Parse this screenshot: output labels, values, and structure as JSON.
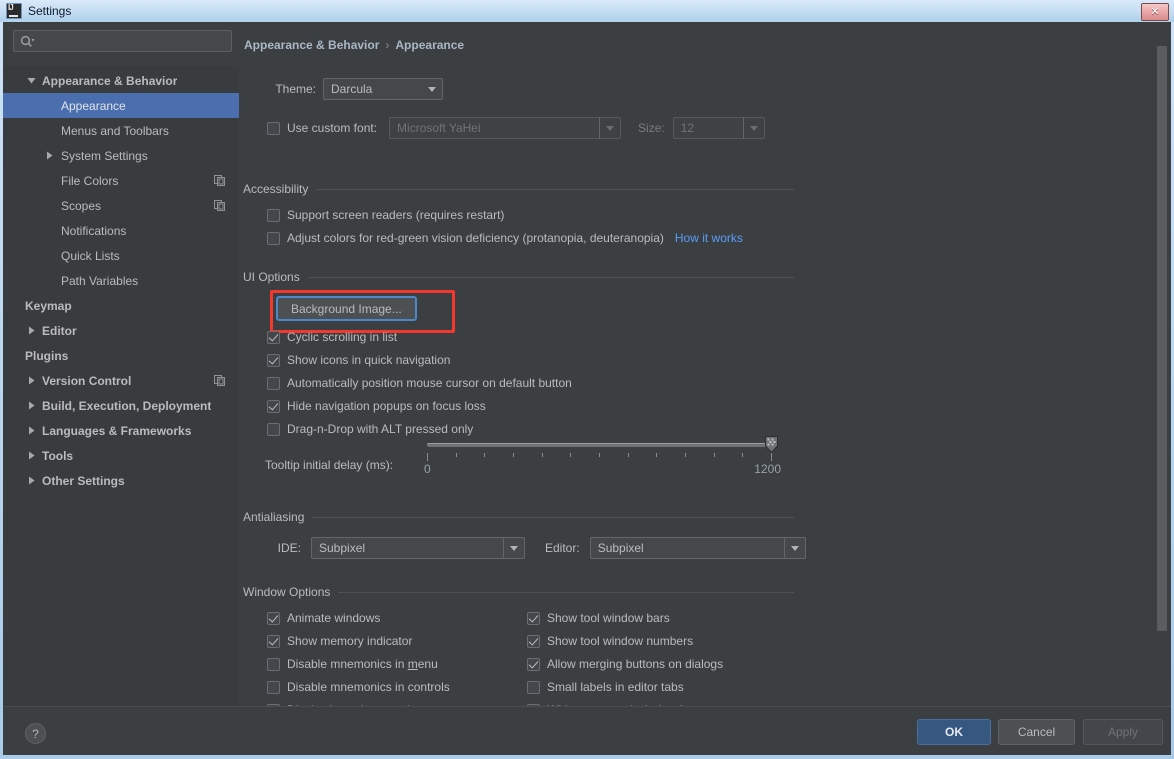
{
  "window": {
    "title": "Settings",
    "close_label": "✕",
    "app_icon": "intellij-idea-icon"
  },
  "sidebar": {
    "search_placeholder": "",
    "search_value": "",
    "search_icon": "search-icon",
    "items": [
      {
        "label": "Appearance & Behavior",
        "level": 0,
        "arrow": "expanded",
        "selected": false,
        "copy_icon": false
      },
      {
        "label": "Appearance",
        "level": 1,
        "arrow": "none",
        "selected": true,
        "copy_icon": false
      },
      {
        "label": "Menus and Toolbars",
        "level": 1,
        "arrow": "none",
        "selected": false,
        "copy_icon": false
      },
      {
        "label": "System Settings",
        "level": 1,
        "arrow": "collapsed",
        "selected": false,
        "copy_icon": false
      },
      {
        "label": "File Colors",
        "level": 1,
        "arrow": "none",
        "selected": false,
        "copy_icon": true
      },
      {
        "label": "Scopes",
        "level": 1,
        "arrow": "none",
        "selected": false,
        "copy_icon": true
      },
      {
        "label": "Notifications",
        "level": 1,
        "arrow": "none",
        "selected": false,
        "copy_icon": false
      },
      {
        "label": "Quick Lists",
        "level": 1,
        "arrow": "none",
        "selected": false,
        "copy_icon": false
      },
      {
        "label": "Path Variables",
        "level": 1,
        "arrow": "none",
        "selected": false,
        "copy_icon": false
      },
      {
        "label": "Keymap",
        "level": 0,
        "arrow": "none",
        "selected": false,
        "copy_icon": false
      },
      {
        "label": "Editor",
        "level": 0,
        "arrow": "collapsed",
        "selected": false,
        "copy_icon": false
      },
      {
        "label": "Plugins",
        "level": 0,
        "arrow": "none",
        "selected": false,
        "copy_icon": false
      },
      {
        "label": "Version Control",
        "level": 0,
        "arrow": "collapsed",
        "selected": false,
        "copy_icon": true
      },
      {
        "label": "Build, Execution, Deployment",
        "level": 0,
        "arrow": "collapsed",
        "selected": false,
        "copy_icon": false
      },
      {
        "label": "Languages & Frameworks",
        "level": 0,
        "arrow": "collapsed",
        "selected": false,
        "copy_icon": false
      },
      {
        "label": "Tools",
        "level": 0,
        "arrow": "collapsed",
        "selected": false,
        "copy_icon": false
      },
      {
        "label": "Other Settings",
        "level": 0,
        "arrow": "collapsed",
        "selected": false,
        "copy_icon": false
      }
    ]
  },
  "breadcrumb": {
    "parent": "Appearance & Behavior",
    "separator": "›",
    "current": "Appearance"
  },
  "theme_row": {
    "label": "Theme:",
    "value": "Darcula"
  },
  "font_row": {
    "checkbox_label": "Use custom font:",
    "checked": false,
    "font_value": "Microsoft YaHei",
    "size_label": "Size:",
    "size_value": "12"
  },
  "accessibility": {
    "title": "Accessibility",
    "items": [
      {
        "label": "Support screen readers (requires restart)",
        "checked": false
      },
      {
        "label": "Adjust colors for red-green vision deficiency (protanopia, deuteranopia)",
        "checked": false
      }
    ],
    "link": "How it works"
  },
  "ui_options": {
    "title": "UI Options",
    "background_image_button": "Background Image...",
    "items": [
      {
        "label": "Cyclic scrolling in list",
        "checked": true
      },
      {
        "label": "Show icons in quick navigation",
        "checked": true
      },
      {
        "label": "Automatically position mouse cursor on default button",
        "checked": false
      },
      {
        "label": "Hide navigation popups on focus loss",
        "checked": true
      },
      {
        "label": "Drag-n-Drop with ALT pressed only",
        "checked": false
      }
    ],
    "slider": {
      "label": "Tooltip initial delay (ms):",
      "min_label": "0",
      "max_label": "1200",
      "min": 0,
      "max": 1200,
      "value": 1200,
      "tick_count": 13
    }
  },
  "antialiasing": {
    "title": "Antialiasing",
    "ide_label": "IDE:",
    "ide_value": "Subpixel",
    "editor_label": "Editor:",
    "editor_value": "Subpixel"
  },
  "window_options": {
    "title": "Window Options",
    "left_column": [
      {
        "label": "Animate windows",
        "checked": true,
        "mnemonic": ""
      },
      {
        "label": "Show memory indicator",
        "checked": true,
        "mnemonic": ""
      },
      {
        "label": "Disable mnemonics in menu",
        "checked": false,
        "mnemonic": "m"
      },
      {
        "label": "Disable mnemonics in controls",
        "checked": false,
        "mnemonic": ""
      },
      {
        "label": "Display icons in menu items",
        "checked": true,
        "mnemonic": ""
      }
    ],
    "right_column": [
      {
        "label": "Show tool window bars",
        "checked": true,
        "mnemonic": ""
      },
      {
        "label": "Show tool window numbers",
        "checked": true,
        "mnemonic": ""
      },
      {
        "label": "Allow merging buttons on dialogs",
        "checked": true,
        "mnemonic": ""
      },
      {
        "label": "Small labels in editor tabs",
        "checked": false,
        "mnemonic": ""
      },
      {
        "label": "Widescreen tool window layout",
        "checked": false,
        "mnemonic": ""
      }
    ]
  },
  "footer": {
    "help_label": "?",
    "ok_label": "OK",
    "cancel_label": "Cancel",
    "apply_label": "Apply"
  },
  "colors": {
    "panel_bg": "#3c3f41",
    "tree_bg": "#393c3e",
    "selection": "#4b6eaf",
    "accent_link": "#589df6",
    "annotation_red": "#f4382e",
    "ok_button": "#365880",
    "titlebar": "#c3dcf2"
  }
}
